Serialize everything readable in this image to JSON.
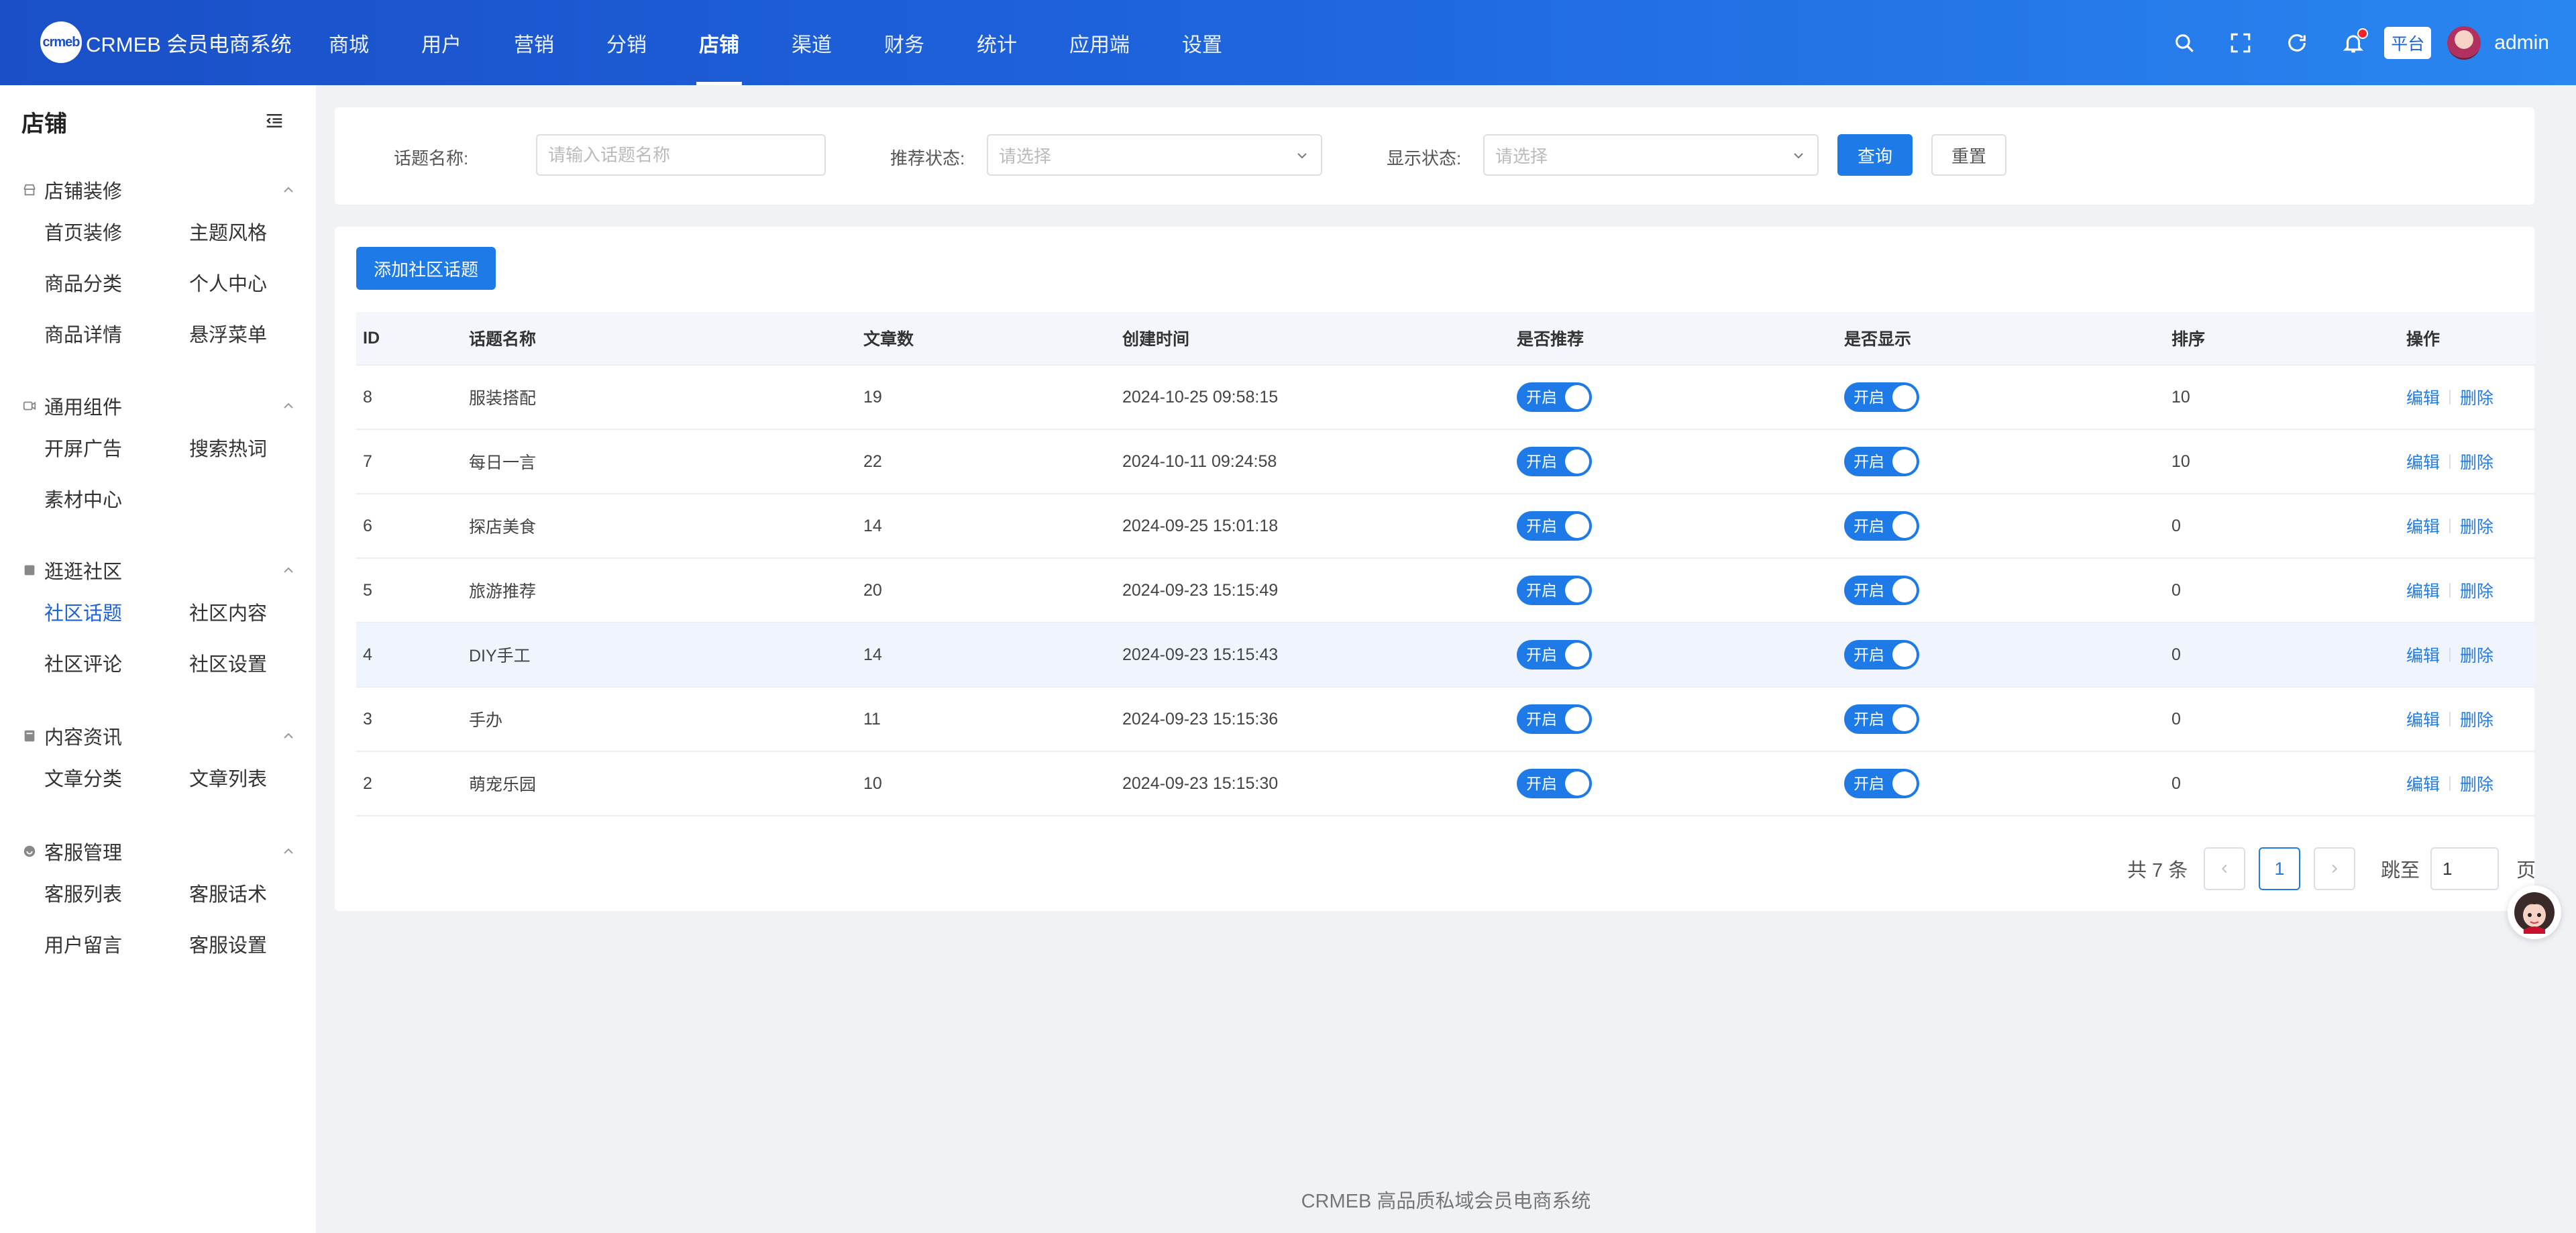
{
  "header": {
    "logo_badge": "crmeb",
    "app_name": "CRMEB 会员电商系统",
    "nav": [
      "商城",
      "用户",
      "营销",
      "分销",
      "店铺",
      "渠道",
      "财务",
      "统计",
      "应用端",
      "设置"
    ],
    "active_nav": "店铺",
    "platform_tag": "平台",
    "user_name": "admin",
    "icons": [
      "search-icon",
      "fullscreen-icon",
      "refresh-icon",
      "bell-icon"
    ]
  },
  "sidebar": {
    "title": "店铺",
    "groups": [
      {
        "label": "店铺装修",
        "items": [
          "首页装修",
          "主题风格",
          "商品分类",
          "个人中心",
          "商品详情",
          "悬浮菜单"
        ]
      },
      {
        "label": "通用组件",
        "items": [
          "开屏广告",
          "搜索热词",
          "素材中心"
        ]
      },
      {
        "label": "逛逛社区",
        "items": [
          "社区话题",
          "社区内容",
          "社区评论",
          "社区设置"
        ]
      },
      {
        "label": "内容资讯",
        "items": [
          "文章分类",
          "文章列表"
        ]
      },
      {
        "label": "客服管理",
        "items": [
          "客服列表",
          "客服话术",
          "用户留言",
          "客服设置"
        ]
      }
    ],
    "active_item": "社区话题"
  },
  "filters": {
    "topic_label": "话题名称:",
    "topic_placeholder": "请输入话题名称",
    "recommend_label": "推荐状态:",
    "recommend_placeholder": "请选择",
    "display_label": "显示状态:",
    "display_placeholder": "请选择",
    "query_button": "查询",
    "reset_button": "重置"
  },
  "table": {
    "add_button": "添加社区话题",
    "columns": [
      "ID",
      "话题名称",
      "文章数",
      "创建时间",
      "是否推荐",
      "是否显示",
      "排序",
      "操作"
    ],
    "switch_label": "开启",
    "edit_label": "编辑",
    "delete_label": "删除",
    "rows": [
      {
        "id": "8",
        "name": "服装搭配",
        "count": "19",
        "created": "2024-10-25 09:58:15",
        "recommend": true,
        "display": true,
        "sort": "10"
      },
      {
        "id": "7",
        "name": "每日一言",
        "count": "22",
        "created": "2024-10-11 09:24:58",
        "recommend": true,
        "display": true,
        "sort": "10"
      },
      {
        "id": "6",
        "name": "探店美食",
        "count": "14",
        "created": "2024-09-25 15:01:18",
        "recommend": true,
        "display": true,
        "sort": "0"
      },
      {
        "id": "5",
        "name": "旅游推荐",
        "count": "20",
        "created": "2024-09-23 15:15:49",
        "recommend": true,
        "display": true,
        "sort": "0"
      },
      {
        "id": "4",
        "name": "DIY手工",
        "count": "14",
        "created": "2024-09-23 15:15:43",
        "recommend": true,
        "display": true,
        "sort": "0"
      },
      {
        "id": "3",
        "name": "手办",
        "count": "11",
        "created": "2024-09-23 15:15:36",
        "recommend": true,
        "display": true,
        "sort": "0"
      },
      {
        "id": "2",
        "name": "萌宠乐园",
        "count": "10",
        "created": "2024-09-23 15:15:30",
        "recommend": true,
        "display": true,
        "sort": "0"
      }
    ]
  },
  "pagination": {
    "total_text": "共 7 条",
    "current_page": "1",
    "jump_label": "跳至",
    "jump_value": "1",
    "page_suffix": "页"
  },
  "footer": {
    "text": "CRMEB 高品质私域会员电商系统"
  },
  "colors": {
    "primary": "#1e7ae6",
    "header_start": "#1a4fc7",
    "header_end": "#2a86f0"
  }
}
